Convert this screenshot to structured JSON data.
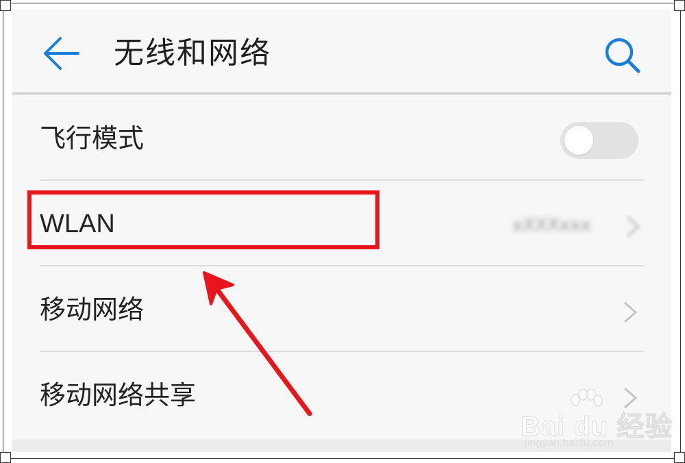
{
  "header": {
    "title": "无线和网络",
    "back_icon": "arrow-left-icon",
    "search_icon": "search-icon"
  },
  "rows": [
    {
      "label": "飞行模式",
      "control": "toggle",
      "toggle_on": false
    },
    {
      "label": "WLAN",
      "control": "value-chevron",
      "value": "xXXXxxx"
    },
    {
      "label": "移动网络",
      "control": "chevron"
    },
    {
      "label": "移动网络共享",
      "control": "chevron"
    }
  ],
  "annotation": {
    "highlight_color": "#e8161c",
    "highlighted_row": "WLAN"
  },
  "watermark": {
    "brand": "Bai du 经验",
    "url": "jingyan.baidu.com"
  },
  "colors": {
    "accent": "#1a7fd6",
    "annotation_red": "#e8161c"
  }
}
